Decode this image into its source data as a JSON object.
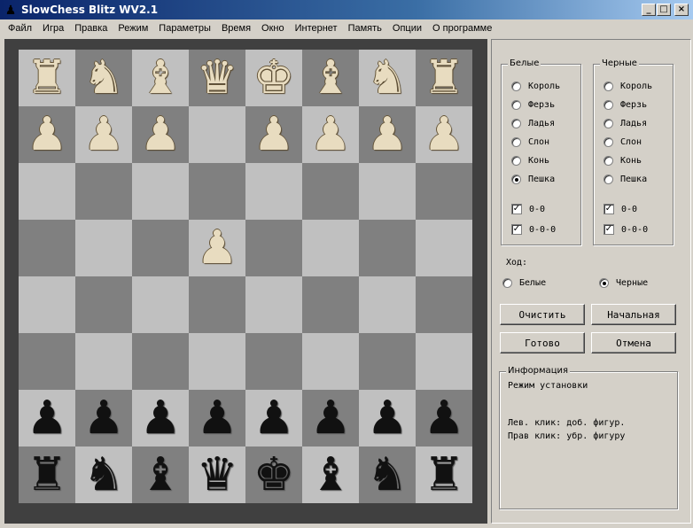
{
  "window": {
    "title": "SlowChess Blitz WV2.1",
    "icon": "chess-pawn-icon",
    "minimize": "_",
    "maximize": "□",
    "close": "×"
  },
  "menu": [
    "Файл",
    "Игра",
    "Правка",
    "Режим",
    "Параметры",
    "Время",
    "Окно",
    "Интернет",
    "Память",
    "Опции",
    "О программе"
  ],
  "board": {
    "rows": [
      [
        "r",
        "n",
        "b",
        "q",
        "k",
        "b",
        "n",
        "r"
      ],
      [
        "p",
        "p",
        "p",
        "",
        "p",
        "p",
        "p",
        "p"
      ],
      [
        "",
        "",
        "",
        "",
        "",
        "",
        "",
        ""
      ],
      [
        "",
        "",
        "",
        "p",
        "",
        "",
        "",
        ""
      ],
      [
        "",
        "",
        "",
        "",
        "",
        "",
        "",
        ""
      ],
      [
        "",
        "",
        "",
        "",
        "",
        "",
        "",
        ""
      ],
      [
        "P",
        "P",
        "P",
        "P",
        "P",
        "P",
        "P",
        "P"
      ],
      [
        "R",
        "N",
        "B",
        "Q",
        "K",
        "B",
        "N",
        "R"
      ]
    ],
    "note": "lowercase = white pieces (top), uppercase = black pieces (bottom)"
  },
  "white_group": {
    "label": "Белые",
    "options": [
      "Король",
      "Ферзь",
      "Ладья",
      "Слон",
      "Конь",
      "Пешка"
    ],
    "selected": "Пешка",
    "castle_short": "0-0",
    "castle_long": "0-0-0",
    "castle_short_checked": true,
    "castle_long_checked": true
  },
  "black_group": {
    "label": "Черные",
    "options": [
      "Король",
      "Ферзь",
      "Ладья",
      "Слон",
      "Конь",
      "Пешка"
    ],
    "selected": "",
    "castle_short": "0-0",
    "castle_long": "0-0-0",
    "castle_short_checked": true,
    "castle_long_checked": true
  },
  "move": {
    "label": "Ход:",
    "white": "Белые",
    "black": "Черные",
    "selected": "Черные"
  },
  "buttons": {
    "clear": "Очистить",
    "initial": "Начальная",
    "done": "Готово",
    "cancel": "Отмена"
  },
  "info": {
    "label": "Информация",
    "lines": [
      "Режим установки",
      "",
      "",
      "Лев. клик: доб. фигур.",
      "Прав клик: убр. фигуру"
    ]
  }
}
